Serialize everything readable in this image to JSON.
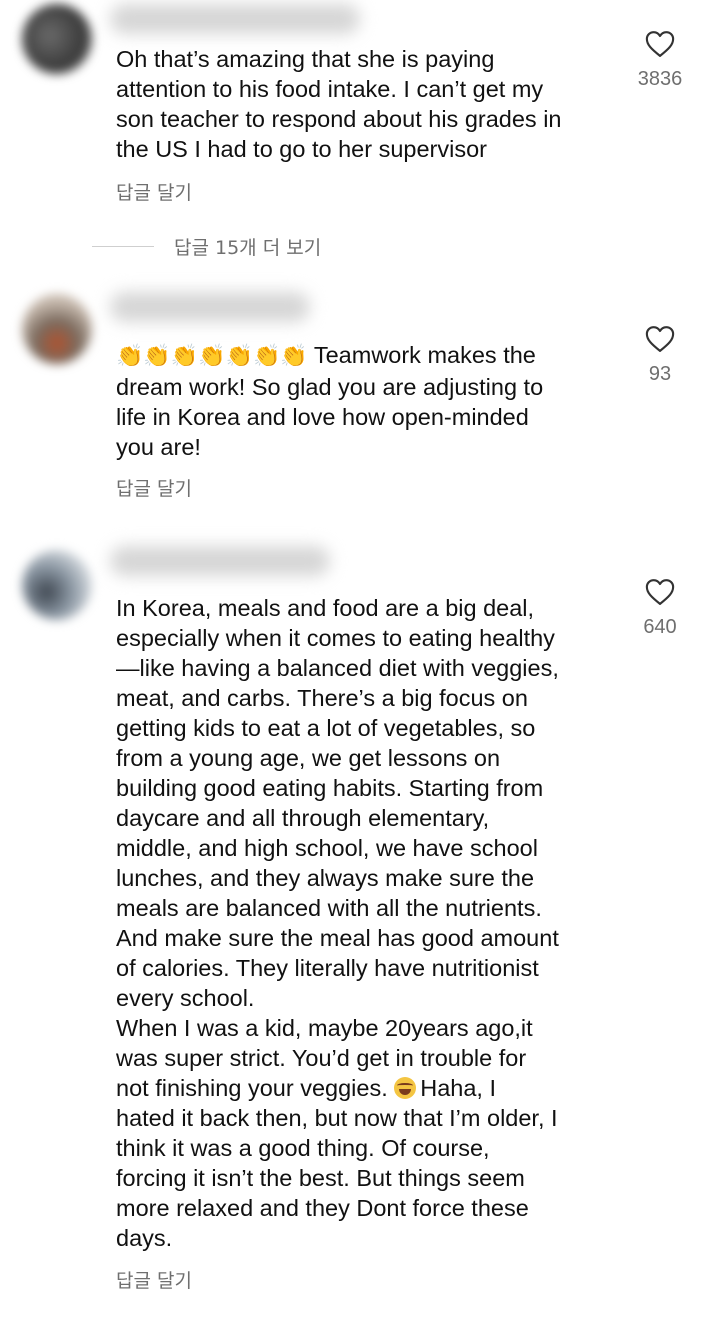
{
  "comments": [
    {
      "text": "Oh that’s amazing that she is paying\nattention to his food intake. I can’t get my\nson teacher to respond about his grades in\nthe US I had to go to her supervisor",
      "reply_label": "답글 달기",
      "likes": "3836",
      "avatar_colors": [
        "#5a5a5a",
        "#8a8a8a"
      ]
    },
    {
      "emoji_prefix": "👏👏👏👏👏👏👏",
      "text": " Teamwork makes the\ndream work! So glad you are adjusting to\nlife in Korea and love how open-minded\nyou are!",
      "reply_label": "답글 달기",
      "likes": "93",
      "avatar_colors": [
        "#7a6e66",
        "#c8b8a8"
      ]
    },
    {
      "text_part1": "In Korea, meals and food are a big deal,\nespecially when it comes to eating healthy\n—like having a balanced diet with veggies,\nmeat, and carbs. There’s a big focus on\ngetting kids to eat a lot of vegetables, so\nfrom a young age, we get lessons on\nbuilding good eating habits. Starting from\ndaycare and all through elementary,\nmiddle, and high school, we have school\nlunches, and they always make sure the\nmeals are balanced with all the nutrients.\nAnd make sure the meal has good amount\nof calories. They literally have nutritionist\nevery school.\nWhen I was a kid, maybe 20years ago,it\nwas super strict. You’d get in trouble for\nnot finishing your veggies. ",
      "emoji_inline": "😂",
      "text_part2": "Haha, I\nhated it back then, but now that I’m older, I\nthink it was a good thing. Of course,\nforcing it isn’t the best. But things seem\nmore relaxed and they Dont force these\ndays.",
      "reply_label": "답글 달기",
      "likes": "640",
      "avatar_colors": [
        "#9aa4b0",
        "#4e5660"
      ]
    }
  ],
  "more_replies_label": "답글 15개 더 보기",
  "colors": {
    "text": "#111111",
    "secondary": "#6f6f6f",
    "background": "#ffffff"
  },
  "icons": {
    "like": "heart-outline-icon"
  }
}
